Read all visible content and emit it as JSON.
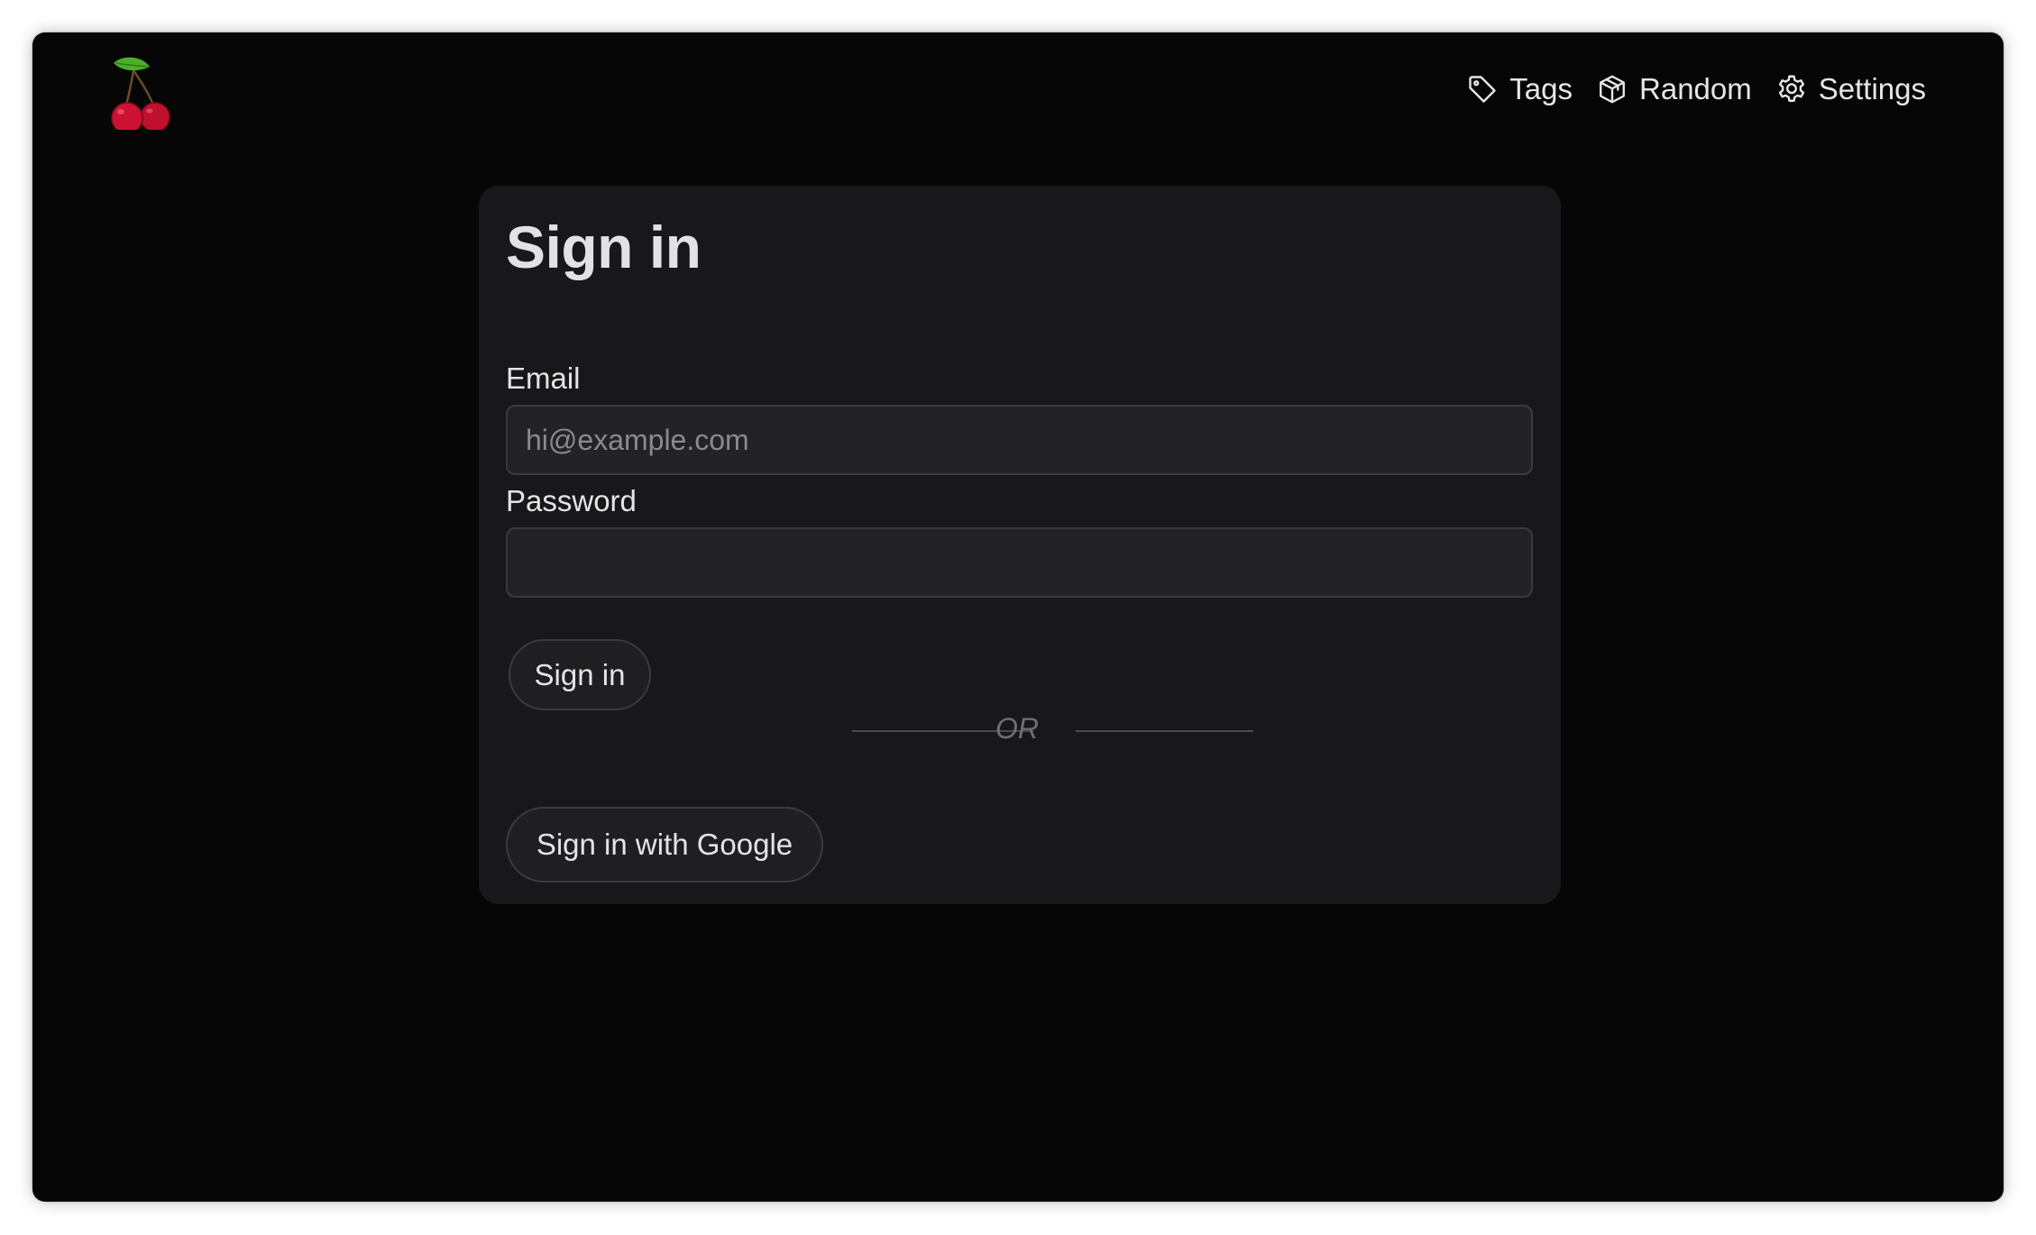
{
  "header": {
    "logo_icon": "cherry-icon",
    "nav": [
      {
        "label": "Tags",
        "icon": "tag-icon"
      },
      {
        "label": "Random",
        "icon": "cube-icon"
      },
      {
        "label": "Settings",
        "icon": "gear-icon"
      }
    ]
  },
  "signin": {
    "title": "Sign in",
    "email_label": "Email",
    "email_placeholder": "hi@example.com",
    "email_value": "",
    "password_label": "Password",
    "password_value": "",
    "submit_label": "Sign in",
    "divider_text": "OR",
    "google_label": "Sign in with Google"
  },
  "colors": {
    "background": "#060606",
    "card": "#18181a",
    "input": "#232325",
    "text": "#e4e4e6",
    "cherry_red": "#c0102e",
    "leaf_green": "#4caf2a"
  }
}
